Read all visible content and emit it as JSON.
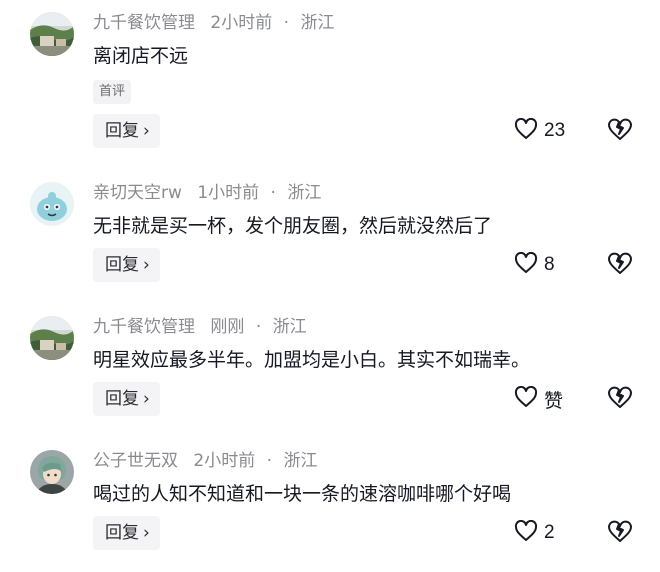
{
  "comments": [
    {
      "username": "九千餐饮管理",
      "time": "2小时前",
      "location": "浙江",
      "text": "离闭店不远",
      "tag": "首评",
      "reply_label": "回复",
      "likes": "23",
      "avatar_icon": "landscape-photo-avatar"
    },
    {
      "username": "亲切天空rw",
      "time": "1小时前",
      "location": "浙江",
      "text": "无非就是买一杯，发个朋友圈，然后就没然后了",
      "reply_label": "回复",
      "likes": "8",
      "avatar_icon": "blue-cartoon-avatar"
    },
    {
      "username": "九千餐饮管理",
      "time": "刚刚",
      "location": "浙江",
      "text": "明星效应最多半年。加盟均是小白。其实不如瑞幸。",
      "reply_label": "回复",
      "likes": "赞",
      "avatar_icon": "landscape-photo-avatar"
    },
    {
      "username": "公子世无双",
      "time": "2小时前",
      "location": "浙江",
      "text": "喝过的人知不知道和一块一条的速溶咖啡哪个好喝",
      "reply_label": "回复",
      "likes": "2",
      "avatar_icon": "anime-character-avatar"
    }
  ],
  "separator": "·",
  "reply_chevron": "›"
}
